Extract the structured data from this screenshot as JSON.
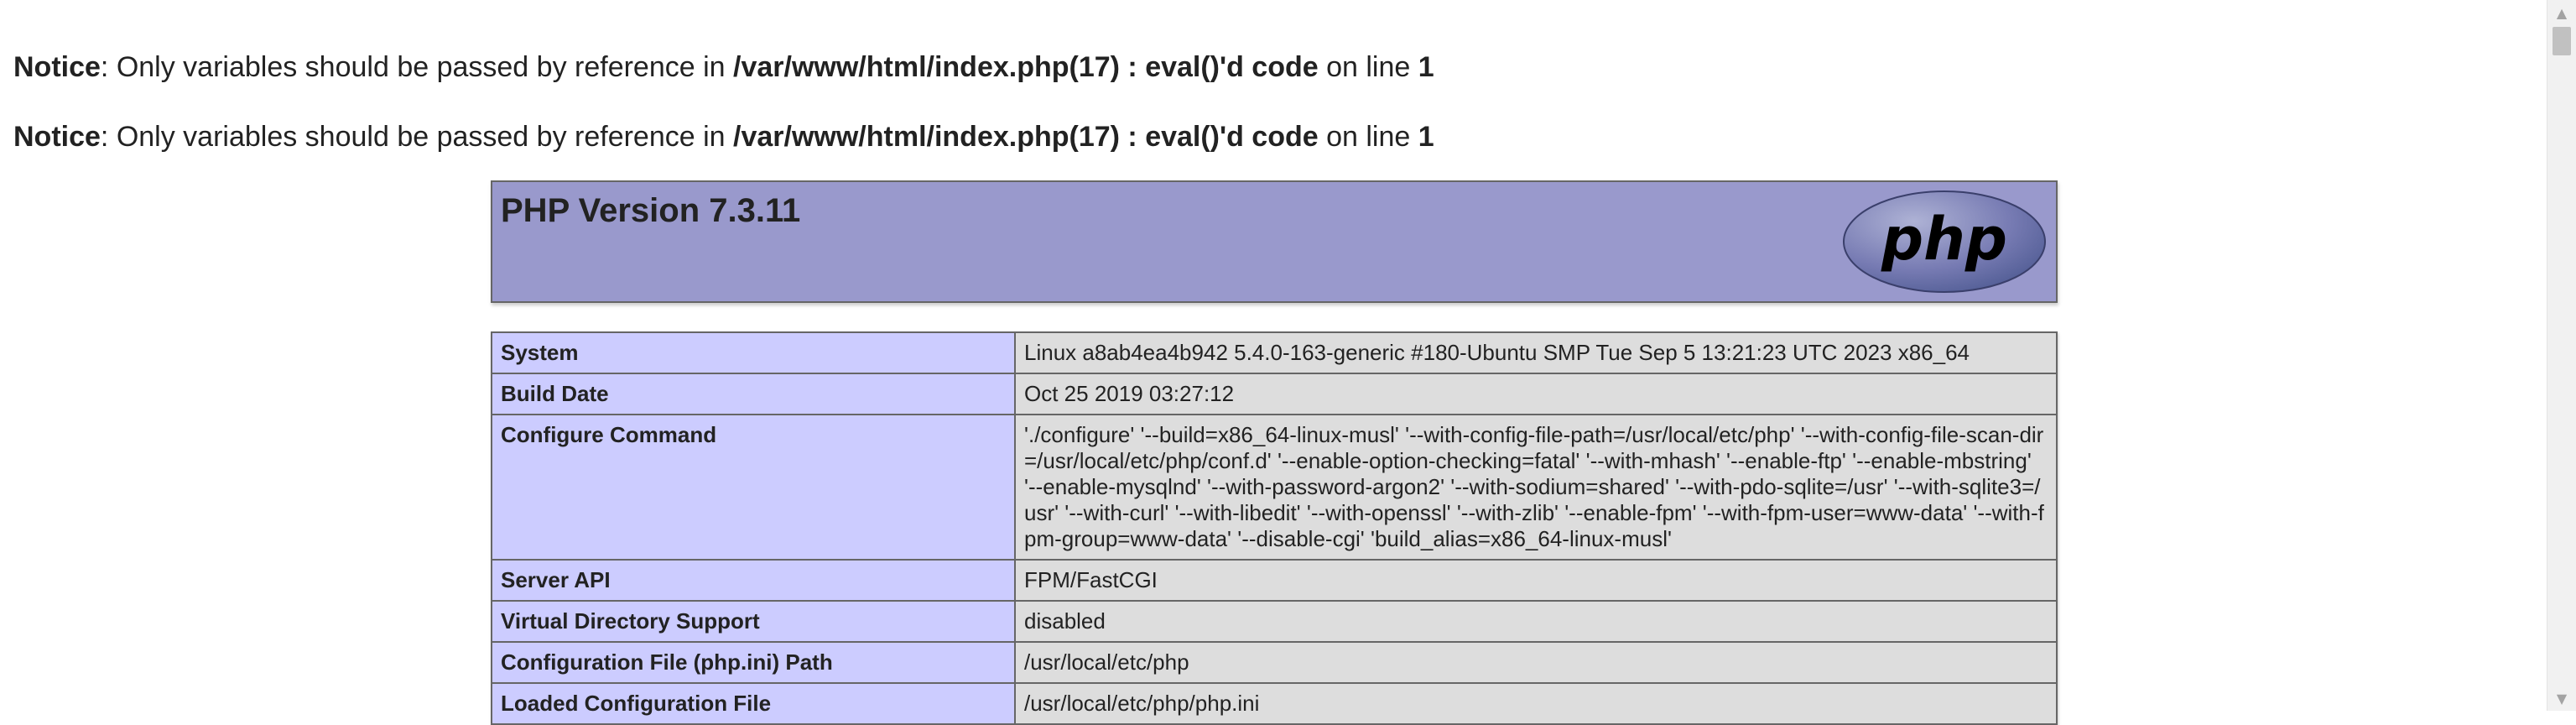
{
  "notices": [
    {
      "label": "Notice",
      "text_before": ": Only variables should be passed by reference in ",
      "file": "/var/www/html/index.php(17) : eval()'d code",
      "text_mid": " on line ",
      "line": "1"
    },
    {
      "label": "Notice",
      "text_before": ": Only variables should be passed by reference in ",
      "file": "/var/www/html/index.php(17) : eval()'d code",
      "text_mid": " on line ",
      "line": "1"
    }
  ],
  "header": {
    "title": "PHP Version 7.3.11",
    "logo_text": "php",
    "colors": {
      "header_bg": "#9999cc",
      "logo_bg": "#6f73a8"
    }
  },
  "info_rows": [
    {
      "key": "System",
      "value": "Linux a8ab4ea4b942 5.4.0-163-generic #180-Ubuntu SMP Tue Sep 5 13:21:23 UTC 2023 x86_64"
    },
    {
      "key": "Build Date",
      "value": "Oct 25 2019 03:27:12"
    },
    {
      "key": "Configure Command",
      "value": "'./configure' '--build=x86_64-linux-musl' '--with-config-file-path=/usr/local/etc/php' '--with-config-file-scan-dir=/usr/local/etc/php/conf.d' '--enable-option-checking=fatal' '--with-mhash' '--enable-ftp' '--enable-mbstring' '--enable-mysqlnd' '--with-password-argon2' '--with-sodium=shared' '--with-pdo-sqlite=/usr' '--with-sqlite3=/usr' '--with-curl' '--with-libedit' '--with-openssl' '--with-zlib' '--enable-fpm' '--with-fpm-user=www-data' '--with-fpm-group=www-data' '--disable-cgi' 'build_alias=x86_64-linux-musl'"
    },
    {
      "key": "Server API",
      "value": "FPM/FastCGI"
    },
    {
      "key": "Virtual Directory Support",
      "value": "disabled"
    },
    {
      "key": "Configuration File (php.ini) Path",
      "value": "/usr/local/etc/php"
    },
    {
      "key": "Loaded Configuration File",
      "value": "/usr/local/etc/php/php.ini"
    }
  ],
  "scrollbar": {
    "up_icon": "▲",
    "down_icon": "▼"
  }
}
